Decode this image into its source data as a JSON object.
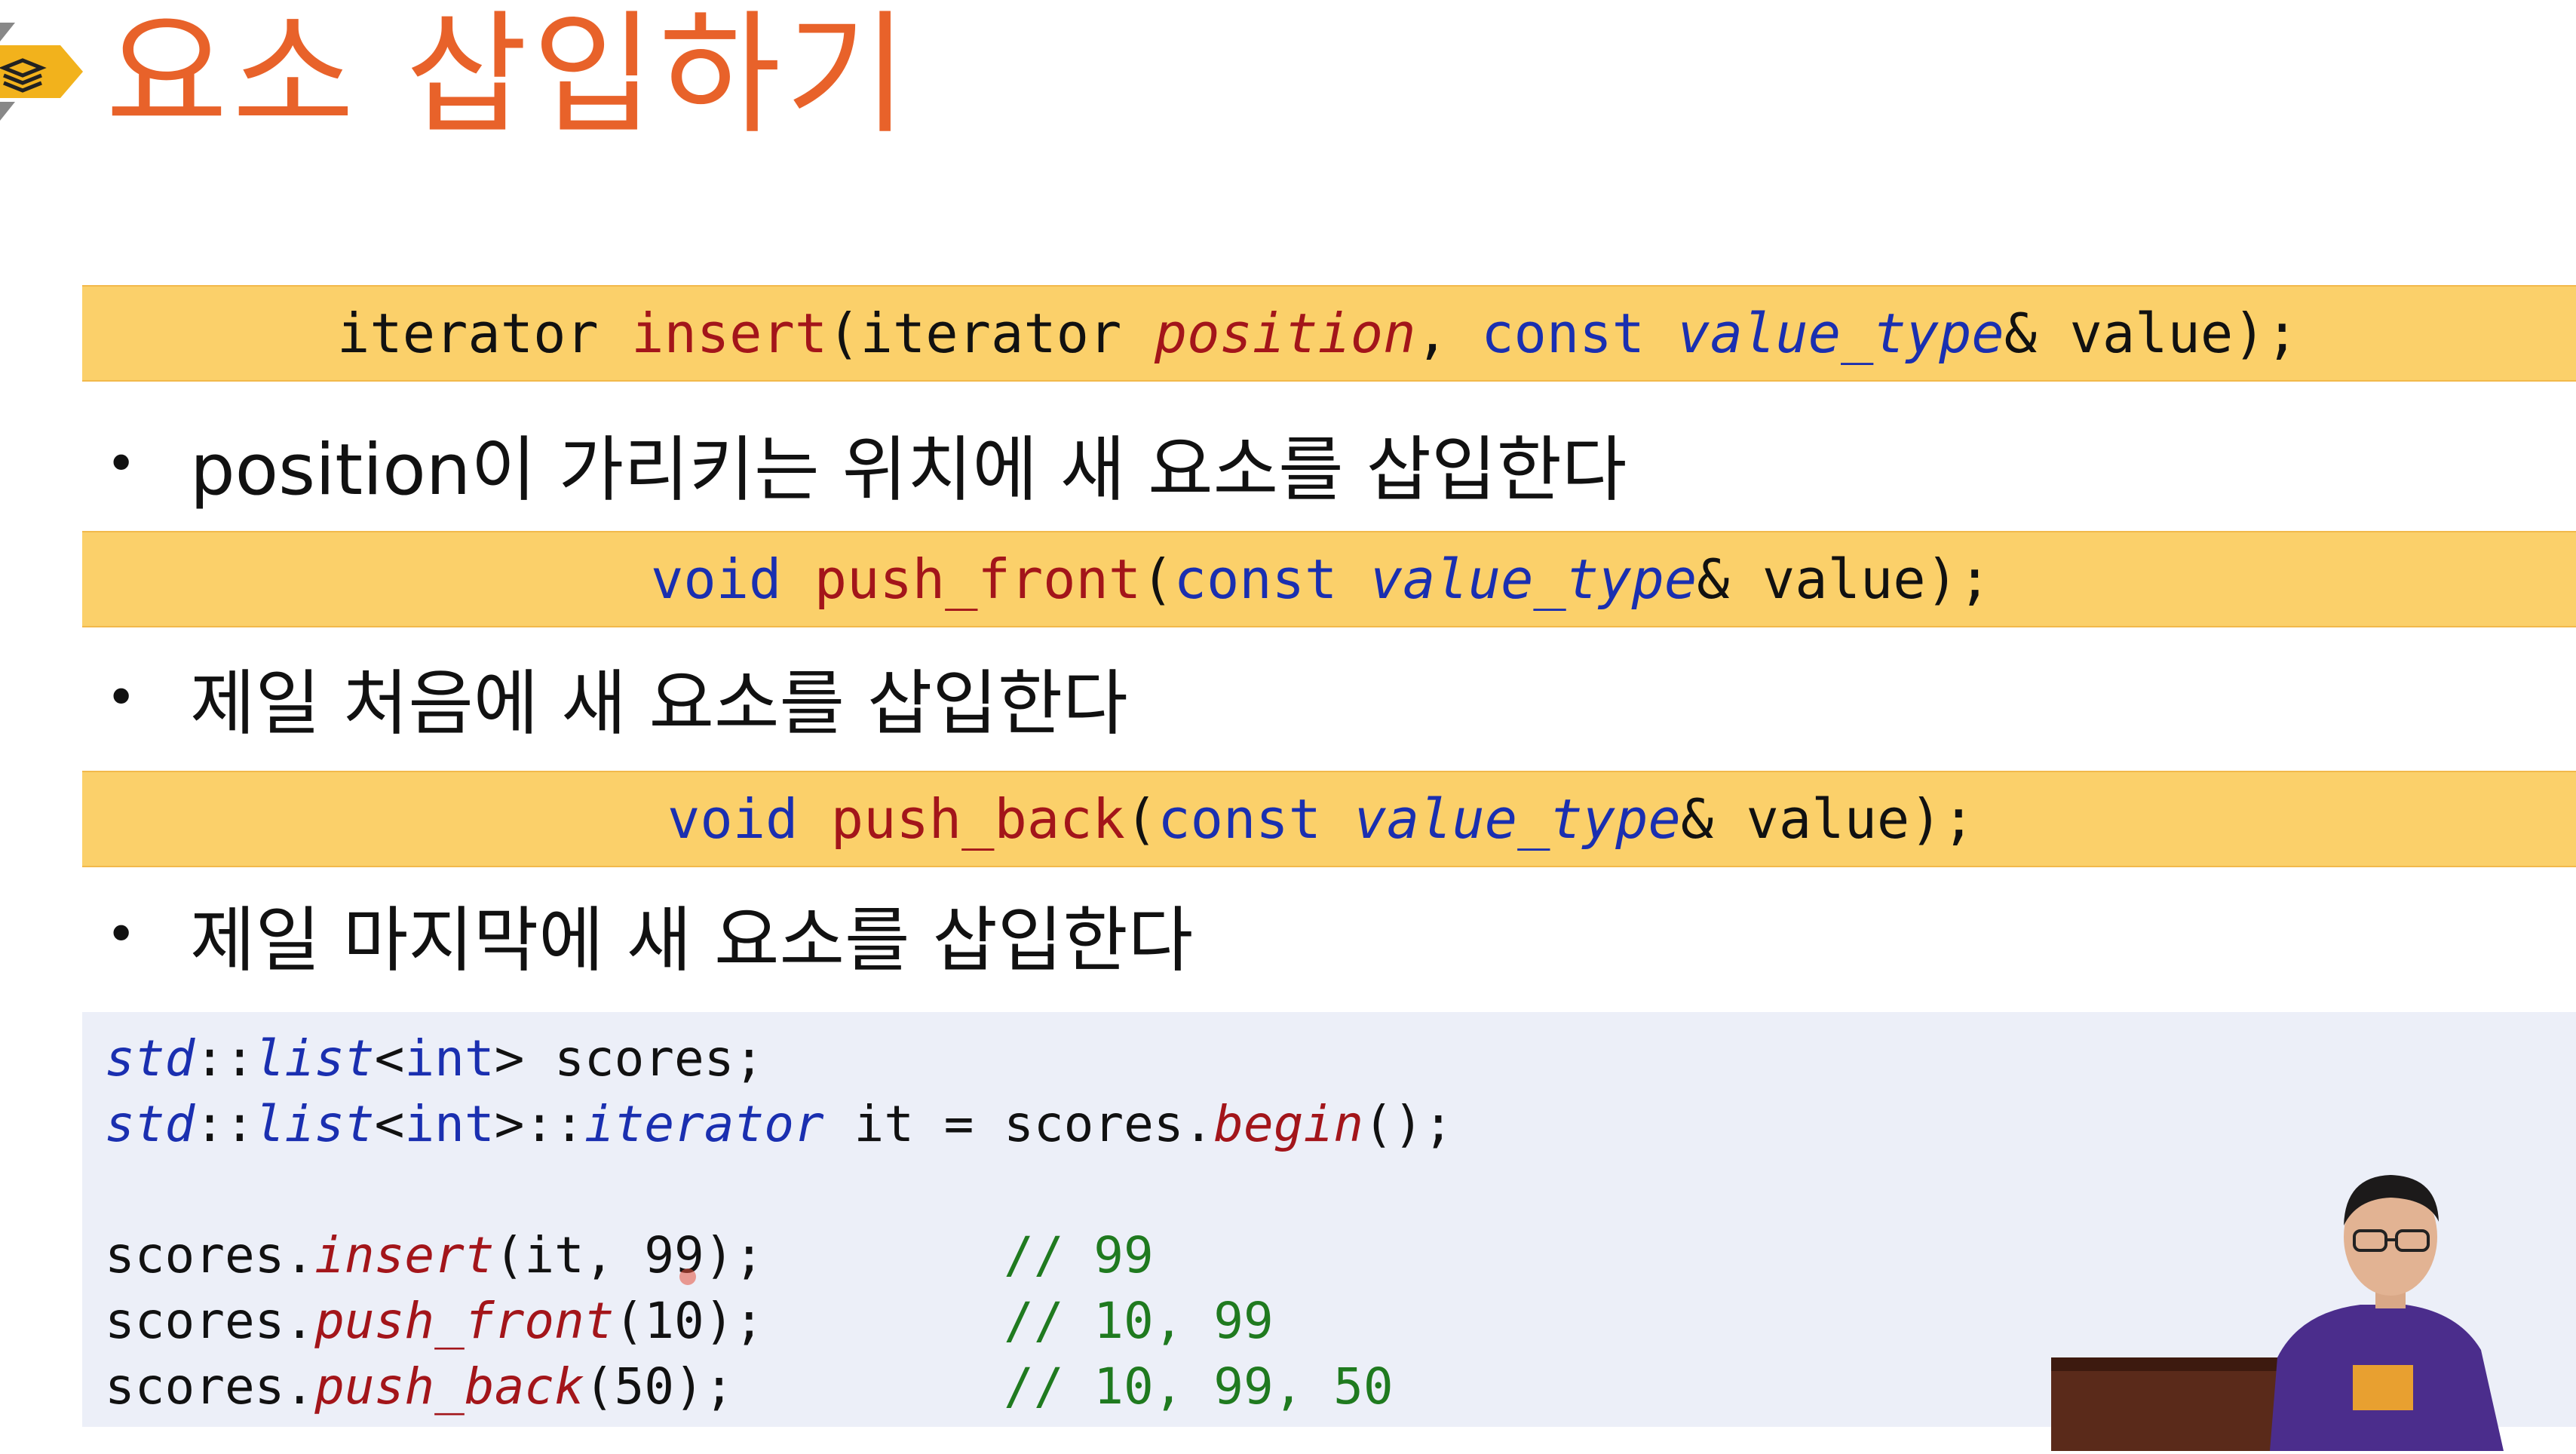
{
  "title": "요소 삽입하기",
  "signatures": [
    {
      "parts": [
        {
          "text": "iterator ",
          "cls": ""
        },
        {
          "text": "insert",
          "cls": "fn"
        },
        {
          "text": "(iterator ",
          "cls": ""
        },
        {
          "text": "position",
          "cls": "fn it"
        },
        {
          "text": ", ",
          "cls": ""
        },
        {
          "text": "const ",
          "cls": "kw"
        },
        {
          "text": "value_type",
          "cls": "kw it"
        },
        {
          "text": "& value);",
          "cls": ""
        }
      ]
    },
    {
      "parts": [
        {
          "text": "void ",
          "cls": "kw"
        },
        {
          "text": "push_front",
          "cls": "fn"
        },
        {
          "text": "(",
          "cls": ""
        },
        {
          "text": "const ",
          "cls": "kw"
        },
        {
          "text": "value_type",
          "cls": "kw it"
        },
        {
          "text": "& value);",
          "cls": ""
        }
      ]
    },
    {
      "parts": [
        {
          "text": "void ",
          "cls": "kw"
        },
        {
          "text": "push_back",
          "cls": "fn"
        },
        {
          "text": "(",
          "cls": ""
        },
        {
          "text": "const ",
          "cls": "kw"
        },
        {
          "text": "value_type",
          "cls": "kw it"
        },
        {
          "text": "& value);",
          "cls": ""
        }
      ]
    }
  ],
  "bullets": [
    "position이 가리키는 위치에 새 요소를 삽입한다",
    "제일 처음에 새 요소를 삽입한다",
    "제일 마지막에 새 요소를 삽입한다"
  ],
  "code_lines": [
    [
      {
        "text": "std",
        "cls": "ty"
      },
      {
        "text": "::",
        "cls": ""
      },
      {
        "text": "list",
        "cls": "ty"
      },
      {
        "text": "<",
        "cls": ""
      },
      {
        "text": "int",
        "cls": "kw2"
      },
      {
        "text": "> scores;",
        "cls": ""
      }
    ],
    [
      {
        "text": "std",
        "cls": "ty"
      },
      {
        "text": "::",
        "cls": ""
      },
      {
        "text": "list",
        "cls": "ty"
      },
      {
        "text": "<",
        "cls": ""
      },
      {
        "text": "int",
        "cls": "kw2"
      },
      {
        "text": ">::",
        "cls": ""
      },
      {
        "text": "iterator",
        "cls": "ty"
      },
      {
        "text": " it = scores.",
        "cls": ""
      },
      {
        "text": "begin",
        "cls": "mf"
      },
      {
        "text": "();",
        "cls": ""
      }
    ],
    [],
    [
      {
        "text": "scores.",
        "cls": ""
      },
      {
        "text": "insert",
        "cls": "mf"
      },
      {
        "text": "(it, 99);        ",
        "cls": ""
      },
      {
        "text": "// 99",
        "cls": "cm"
      }
    ],
    [
      {
        "text": "scores.",
        "cls": ""
      },
      {
        "text": "push_front",
        "cls": "mf"
      },
      {
        "text": "(10);        ",
        "cls": ""
      },
      {
        "text": "// 10, 99",
        "cls": "cm"
      }
    ],
    [
      {
        "text": "scores.",
        "cls": ""
      },
      {
        "text": "push_back",
        "cls": "mf"
      },
      {
        "text": "(50);         ",
        "cls": ""
      },
      {
        "text": "// 10, 99, 50",
        "cls": "cm"
      }
    ]
  ],
  "colors": {
    "title": "#e8622a",
    "signature_bg": "#fbd06a",
    "code_bg": "#eceff8",
    "keyword": "#1a2fb0",
    "function": "#a3151a",
    "comment": "#1f7a1f"
  }
}
